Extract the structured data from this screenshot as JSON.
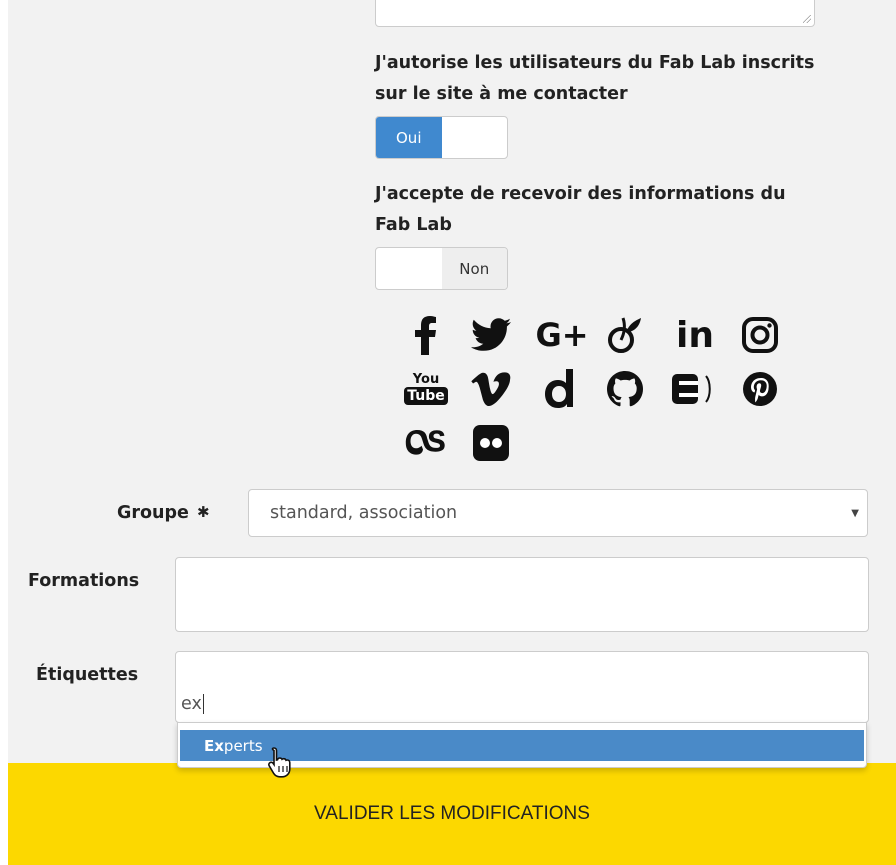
{
  "contact_consent": {
    "label_line1": "J'autorise les utilisateurs du Fab Lab inscrits",
    "label_line2": "sur le site à me contacter",
    "toggle_value": "Oui"
  },
  "newsletter_consent": {
    "label_line1": "J'accepte de recevoir des informations du",
    "label_line2": "Fab Lab",
    "toggle_value": "Non"
  },
  "social_networks": {
    "row1": [
      "facebook-icon",
      "twitter-icon",
      "google-plus-icon",
      "viadeo-icon",
      "linkedin-icon",
      "instagram-icon"
    ],
    "row2": [
      "youtube-icon",
      "vimeo-icon",
      "dailymotion-icon",
      "github-icon",
      "echosciences-icon",
      "pinterest-icon"
    ],
    "row3": [
      "lastfm-icon",
      "flickr-icon"
    ],
    "youtube_text_top": "You",
    "youtube_text_bottom": "Tube",
    "gplus_text": "G+",
    "linkedin_text": "in"
  },
  "group": {
    "label": "Groupe",
    "required_mark": "✱",
    "value": "standard, association"
  },
  "trainings": {
    "label": "Formations",
    "value": ""
  },
  "tags": {
    "label": "Étiquettes",
    "typed": "ex",
    "suggestion_match": "Ex",
    "suggestion_rest": "perts"
  },
  "submit": {
    "label": "VALIDER LES MODIFICATIONS"
  },
  "colors": {
    "panel_bg": "#f2f2f2",
    "toggle_on": "#4089cf",
    "dropdown_highlight": "#4a8ac8",
    "submit_bg": "#fcd800"
  }
}
